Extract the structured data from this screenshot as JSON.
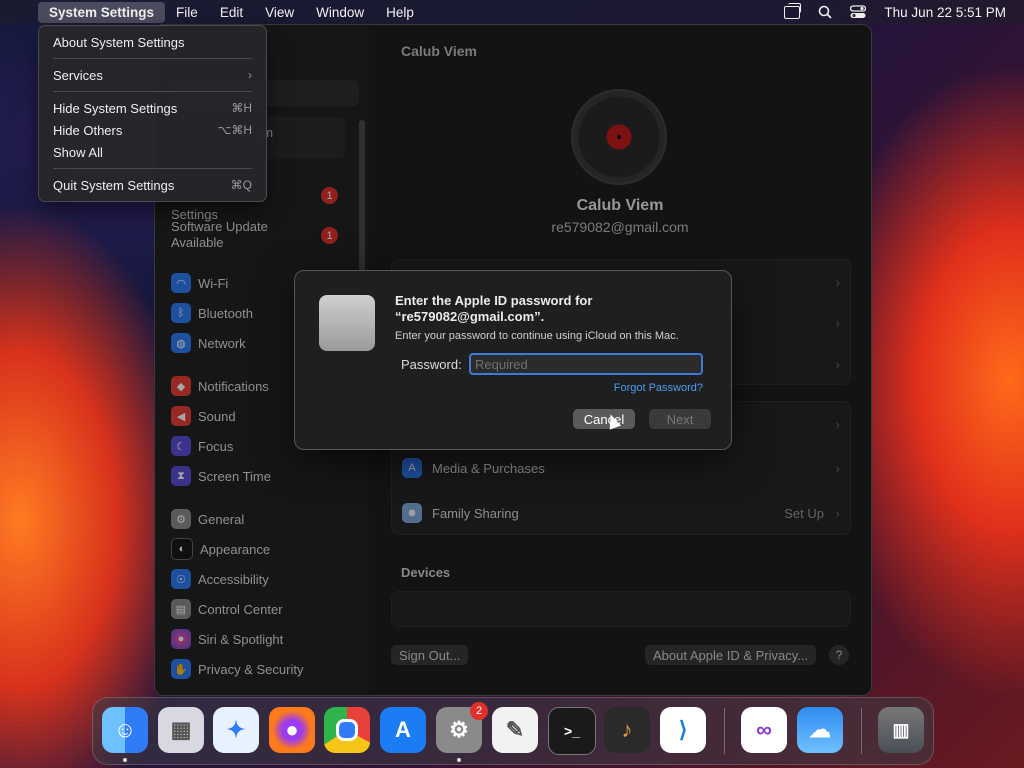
{
  "menubar": {
    "apple": "",
    "app_name": "System Settings",
    "items": [
      "File",
      "Edit",
      "View",
      "Window",
      "Help"
    ],
    "date_time": "Thu Jun 22  5:51 PM"
  },
  "app_menu": {
    "items": [
      {
        "label": "About System Settings",
        "shortcut": ""
      },
      {
        "label": "Services",
        "shortcut": "›"
      },
      {
        "label": "Hide System Settings",
        "shortcut": "⌘H"
      },
      {
        "label": "Hide Others",
        "shortcut": "⌥⌘H"
      },
      {
        "label": "Show All",
        "shortcut": ""
      },
      {
        "label": "Quit System Settings",
        "shortcut": "⌘Q"
      }
    ]
  },
  "sidebar": {
    "profile_partial": "em",
    "notices": [
      {
        "label_line1": "",
        "label_line2": "Settings",
        "badge": "1"
      },
      {
        "label_line1": "Software Update",
        "label_line2": "Available",
        "badge": "1"
      }
    ],
    "items": [
      {
        "label": "Wi-Fi",
        "icon": "wifi-icon",
        "color": "#2f7cf6"
      },
      {
        "label": "Bluetooth",
        "icon": "bluetooth-icon",
        "color": "#2f7cf6"
      },
      {
        "label": "Network",
        "icon": "globe-icon",
        "color": "#2f7cf6"
      },
      {
        "label": "Notifications",
        "icon": "bell-icon",
        "color": "#e8403a"
      },
      {
        "label": "Sound",
        "icon": "speaker-icon",
        "color": "#e8403a"
      },
      {
        "label": "Focus",
        "icon": "moon-icon",
        "color": "#5b4fd6"
      },
      {
        "label": "Screen Time",
        "icon": "hourglass-icon",
        "color": "#5b4fd6"
      },
      {
        "label": "General",
        "icon": "gear-icon",
        "color": "#8a8a8a"
      },
      {
        "label": "Appearance",
        "icon": "appearance-icon",
        "color": "#1a1a1a"
      },
      {
        "label": "Accessibility",
        "icon": "accessibility-icon",
        "color": "#2f7cf6"
      },
      {
        "label": "Control Center",
        "icon": "control-center-icon",
        "color": "#8a8a8a"
      },
      {
        "label": "Siri & Spotlight",
        "icon": "siri-icon",
        "color": "#b23ad0"
      },
      {
        "label": "Privacy & Security",
        "icon": "hand-icon",
        "color": "#2f7cf6"
      }
    ]
  },
  "main": {
    "title": "Calub Viem",
    "name": "Calub Viem",
    "email": "re579082@gmail.com",
    "rows": [
      {
        "label": "Media & Purchases",
        "value": "",
        "icon": "app-store-icon",
        "color": "#2f7cf6"
      },
      {
        "label": "Family Sharing",
        "value": "Set Up",
        "icon": "family-icon",
        "color": "#7fa9d8"
      }
    ],
    "devices_title": "Devices",
    "sign_out": "Sign Out...",
    "about": "About Apple ID & Privacy...",
    "help": "?"
  },
  "dialog": {
    "title": "Enter the Apple ID password for “re579082@gmail.com”.",
    "subtitle": "Enter your password to continue using iCloud on this Mac.",
    "password_label": "Password:",
    "password_placeholder": "Required",
    "forgot": "Forgot Password?",
    "cancel": "Cancel",
    "next": "Next"
  },
  "dock": {
    "apps": [
      {
        "name": "finder-icon",
        "color": "#2f8cf0",
        "glyph": "☺",
        "running": true
      },
      {
        "name": "launchpad-icon",
        "color": "#d8d8e0",
        "glyph": "▦",
        "running": false
      },
      {
        "name": "safari-icon",
        "color": "#e8f2ff",
        "glyph": "✦",
        "running": false
      },
      {
        "name": "firefox-icon",
        "color": "#ff7a1a",
        "glyph": "●",
        "running": false
      },
      {
        "name": "chrome-icon",
        "color": "#f1f1f1",
        "glyph": "◉",
        "running": false
      },
      {
        "name": "app-store-icon",
        "color": "#1c7cf4",
        "glyph": "A",
        "running": false
      },
      {
        "name": "system-settings-icon",
        "color": "#8a8a8a",
        "glyph": "⚙",
        "running": true,
        "badge": "2"
      },
      {
        "name": "textedit-icon",
        "color": "#f2f2f2",
        "glyph": "✎",
        "running": false
      },
      {
        "name": "terminal-icon",
        "color": "#1a1a1a",
        "glyph": ">_",
        "running": false
      },
      {
        "name": "garageband-icon",
        "color": "#2a2a2a",
        "glyph": "♪",
        "running": false
      },
      {
        "name": "vscode-icon",
        "color": "#ffffff",
        "glyph": "⟩",
        "running": false
      },
      {
        "name": "visual-studio-icon",
        "color": "#ffffff",
        "glyph": "∞",
        "running": false
      },
      {
        "name": "weather-icon",
        "color": "#2f8cf0",
        "glyph": "☁",
        "running": false
      },
      {
        "name": "trash-icon",
        "color": "#555a62",
        "glyph": "🗑",
        "running": false
      }
    ]
  }
}
